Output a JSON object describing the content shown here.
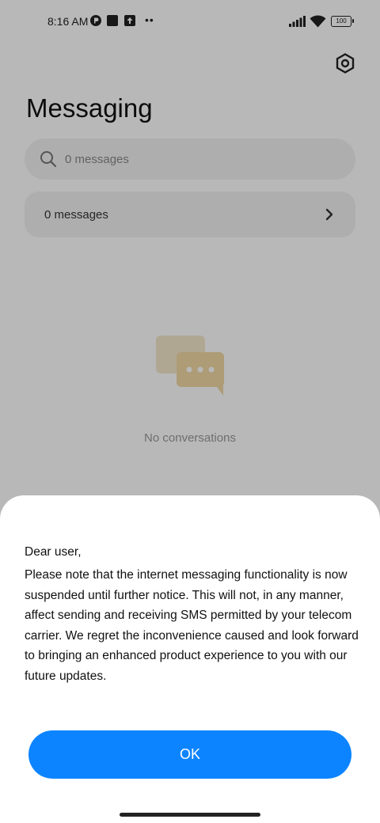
{
  "status_bar": {
    "time": "8:16 AM",
    "battery": "100",
    "more": "••"
  },
  "app": {
    "title": "Messaging",
    "search": {
      "placeholder": "0 messages"
    },
    "row": {
      "label": "0 messages"
    },
    "empty_state": {
      "text": "No conversations"
    }
  },
  "dialog": {
    "greeting": "Dear user,",
    "message": "Please note that the internet messaging functionality is now suspended until further notice. This will not, in any manner, affect sending and receiving SMS permitted by your telecom carrier. We regret the inconvenience caused and look forward to bringing an enhanced product experience to you with our future updates.",
    "ok_label": "OK"
  },
  "colors": {
    "accent": "#0d84ff",
    "illustration": "#f0d9a4"
  },
  "icons": [
    "settings-icon",
    "search-icon",
    "chevron-right-icon",
    "chat-bubbles-icon",
    "signal-icon",
    "wifi-icon",
    "battery-icon"
  ]
}
